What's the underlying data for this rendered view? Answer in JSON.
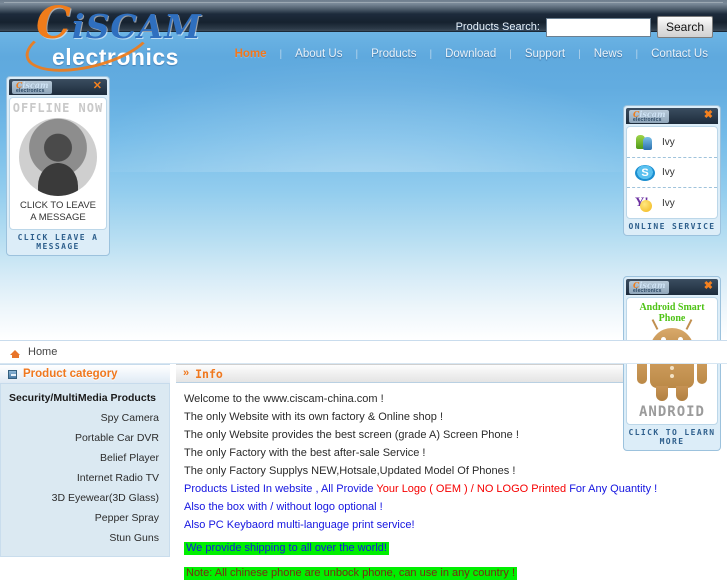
{
  "brand": {
    "logo_main": "iSCAM",
    "logo_initial": "C",
    "logo_sub": "electronics"
  },
  "search": {
    "label": "Products Search:",
    "value": "",
    "placeholder": "",
    "button": "Search"
  },
  "nav": {
    "items": [
      {
        "label": "Home",
        "active": true
      },
      {
        "label": "About Us",
        "active": false
      },
      {
        "label": "Products",
        "active": false
      },
      {
        "label": "Download",
        "active": false
      },
      {
        "label": "Support",
        "active": false
      },
      {
        "label": "News",
        "active": false
      },
      {
        "label": "Contact Us",
        "active": false
      }
    ],
    "separator": "|"
  },
  "offline_widget": {
    "logo_initial": "C",
    "logo_main": "iscam",
    "logo_sub": "electronics",
    "close": "✕",
    "status": "OFFLINE NOW",
    "message_line1": "CLICK TO LEAVE",
    "message_line2": "A MESSAGE",
    "footer": "CLICK LEAVE A MESSAGE"
  },
  "online_widget": {
    "logo_initial": "C",
    "logo_main": "iscam",
    "logo_sub": "electronics",
    "close": "✖",
    "footer": "ONLINE SERVICE",
    "contacts": [
      {
        "service": "msn-icon",
        "name": "Ivy"
      },
      {
        "service": "skype-icon",
        "name": "Ivy"
      },
      {
        "service": "yahoo-icon",
        "name": "Ivy"
      }
    ]
  },
  "android_widget": {
    "logo_initial": "C",
    "logo_main": "iscam",
    "logo_sub": "electronics",
    "close": "✖",
    "title": "Android Smart Phone",
    "wordmark": "ANDROID",
    "footer": "CLICK TO LEARN MORE",
    "title_color": "#4fc316"
  },
  "breadcrumb": {
    "home": "Home"
  },
  "sidebar": {
    "header": "Product category",
    "group": "Security/MultiMedia Products",
    "items": [
      {
        "label": "Spy Camera"
      },
      {
        "label": "Portable Car DVR"
      },
      {
        "label": "Belief Player"
      },
      {
        "label": "Internet Radio TV"
      },
      {
        "label": "3D Eyewear(3D Glass)"
      },
      {
        "label": "Pepper Spray"
      },
      {
        "label": "Stun Guns"
      }
    ]
  },
  "info": {
    "header": "Info",
    "lines": [
      {
        "text": "Welcome to the www.ciscam-china.com   !",
        "style": "plain"
      },
      {
        "text": "The only Website with its own factory & Online shop !",
        "style": "plain"
      },
      {
        "text": "The only Website provides the best screen (grade A) Screen Phone !",
        "style": "plain"
      },
      {
        "text": "The only Factory with the best  after-sale Service !",
        "style": "plain"
      },
      {
        "text": "The only Factory Supplys NEW,Hotsale,Updated Model Of Phones !",
        "style": "plain"
      },
      {
        "text": "Also the box with / without logo optional !",
        "style": "blue"
      },
      {
        "text": "Also PC Keybaord multi-language print service!",
        "style": "blue"
      },
      {
        "text": "We provide shipping to all over the world!",
        "style": "highlight-blue"
      },
      {
        "text": "Note:  All chinese phone are unbock phone, can use in any country !",
        "style": "highlight-dark"
      }
    ],
    "mixed_line": {
      "part1": "Products Listed In website , All Provide ",
      "part2": "Your Logo  ( OEM ) / NO LOGO Printed ",
      "part3": " For Any Quantity !"
    }
  },
  "colors": {
    "accent_orange": "#f0781e",
    "brand_blue": "#2f6fbf",
    "highlight_green": "#00ef00",
    "link_blue": "#1515e0",
    "alert_red": "#f60000"
  }
}
